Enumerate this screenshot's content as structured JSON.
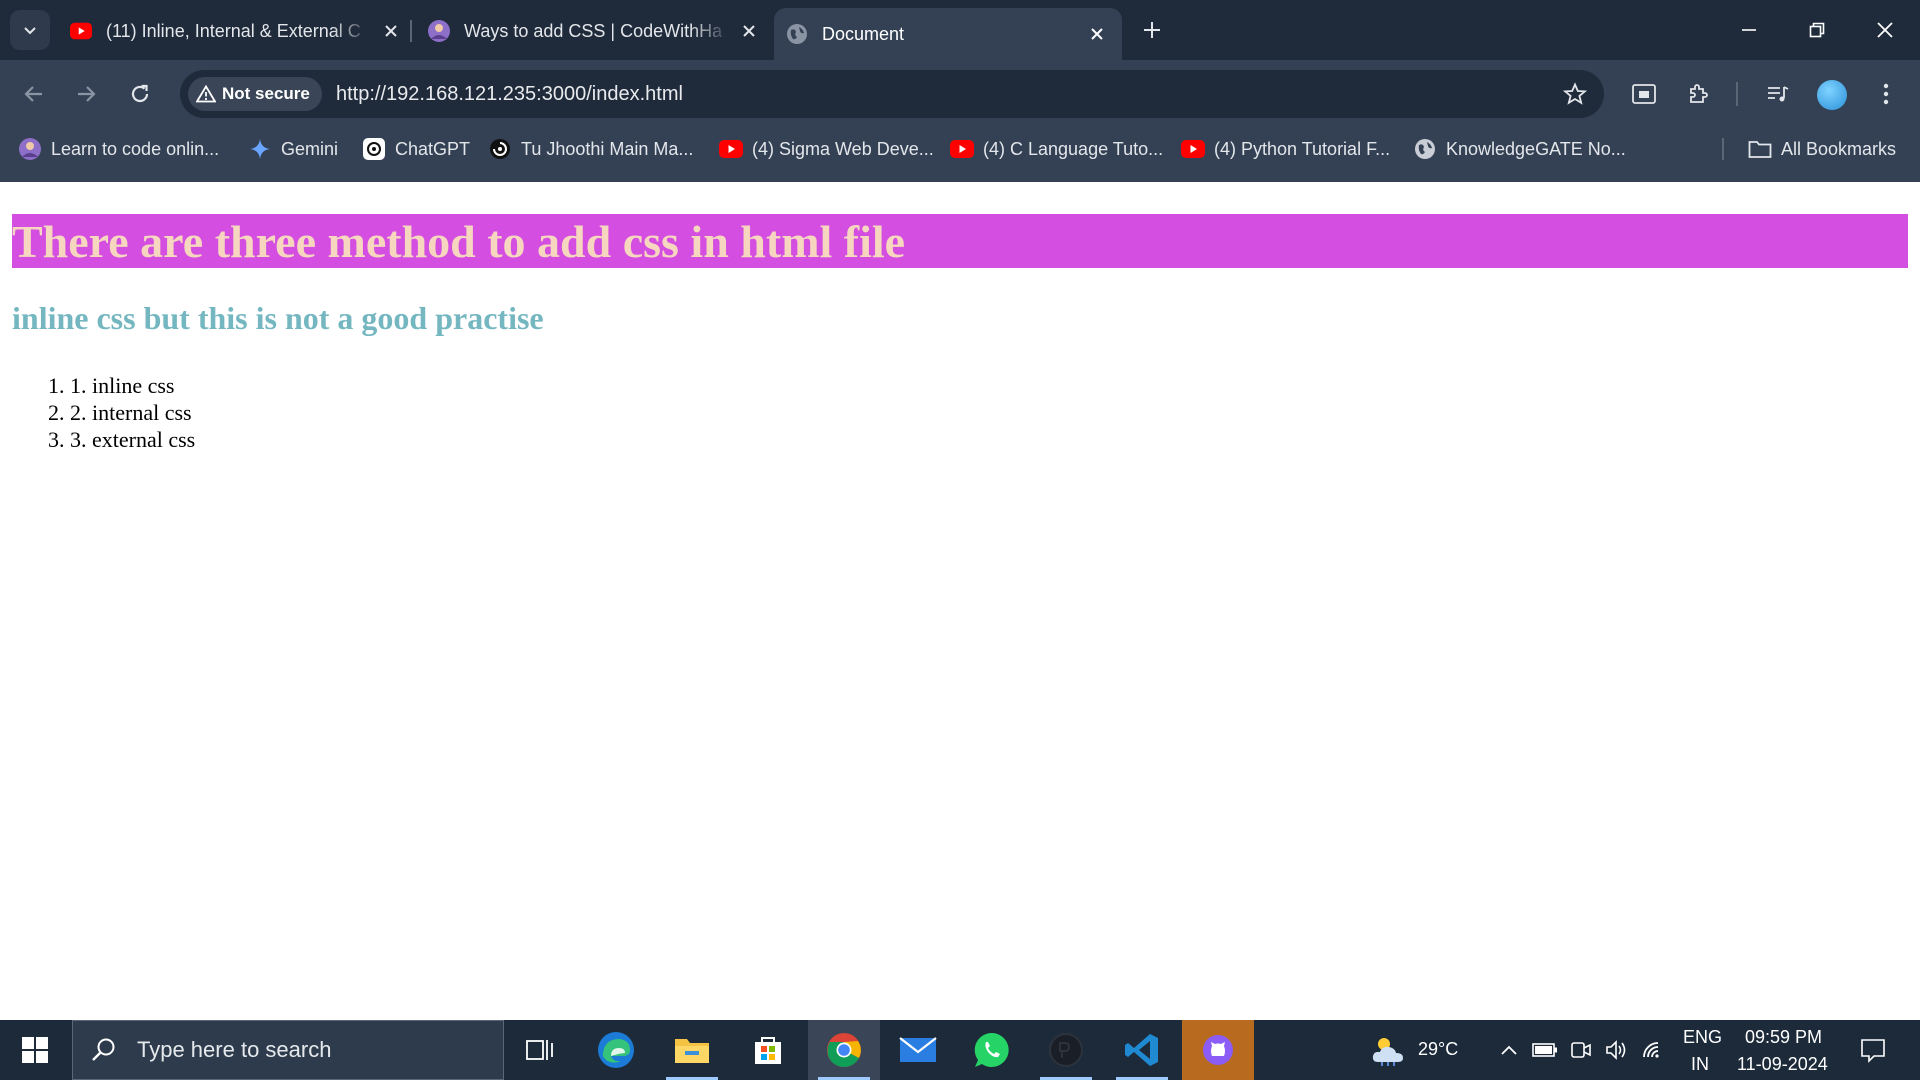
{
  "browser": {
    "tabs": [
      {
        "title": "(11) Inline, Internal & External C",
        "favicon": "youtube-icon"
      },
      {
        "title": "Ways to add CSS | CodeWithHa",
        "favicon": "avatar-icon"
      },
      {
        "title": "Document",
        "favicon": "globe-icon",
        "active": true
      }
    ],
    "address": {
      "security_label": "Not secure",
      "url": "http://192.168.121.235:3000/index.html"
    },
    "bookmarks": [
      {
        "label": "Learn to code onlin...",
        "icon": "avatar-icon"
      },
      {
        "label": "Gemini",
        "icon": "gemini-icon"
      },
      {
        "label": "ChatGPT",
        "icon": "chatgpt-icon"
      },
      {
        "label": "Tu Jhoothi Main Ma...",
        "icon": "disc-icon"
      },
      {
        "label": "(4) Sigma Web Deve...",
        "icon": "youtube-icon"
      },
      {
        "label": "(4) C Language Tuto...",
        "icon": "youtube-icon"
      },
      {
        "label": "(4) Python Tutorial F...",
        "icon": "youtube-icon"
      },
      {
        "label": "KnowledgeGATE No...",
        "icon": "globe-icon"
      }
    ],
    "all_bookmarks_label": "All Bookmarks"
  },
  "page": {
    "heading": "There are three method to add css in html file",
    "subheading": "inline css but this is not a good practise",
    "methods": [
      "1. inline css",
      "2. internal css",
      "3. external css"
    ],
    "colors": {
      "heading_bg": "#d44fe1",
      "heading_text": "#f6d6bf",
      "subheading_text": "#74b7c1"
    }
  },
  "taskbar": {
    "search_placeholder": "Type here to search",
    "weather": "29°C",
    "language_top": "ENG",
    "language_bottom": "IN",
    "time": "09:59 PM",
    "date": "11-09-2024"
  },
  "theme": {
    "titlebar": "#1f2a3a",
    "toolbar": "#344154",
    "taskbar": "#1c2a3a"
  }
}
